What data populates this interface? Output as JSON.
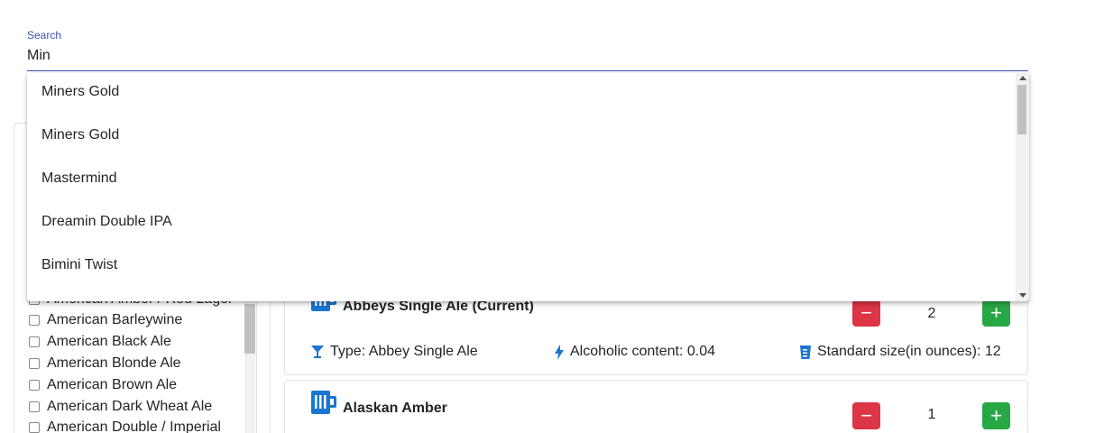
{
  "search": {
    "label": "Search",
    "value": "Min",
    "accent_color": "#3f51b5"
  },
  "autocomplete": {
    "options": [
      "Miners Gold",
      "Miners Gold",
      "Mastermind",
      "Dreamin Double IPA",
      "Bimini Twist"
    ]
  },
  "filters": {
    "items": [
      "American Amber / Red Lager",
      "American Barleywine",
      "American Black Ale",
      "American Blonde Ale",
      "American Brown Ale",
      "American Dark Wheat Ale",
      "American Double / Imperial"
    ]
  },
  "beers": [
    {
      "name": "Abbeys Single Ale (Current)",
      "quantity": "2",
      "type": "Type: Abbey Single Ale",
      "alcohol": "Alcoholic content: 0.04",
      "size": "Standard size(in ounces): 12",
      "icon": "beer-mug-icon"
    },
    {
      "name": "Alaskan Amber",
      "quantity": "1",
      "icon": "beer-mug-icon"
    }
  ],
  "buttons": {
    "minus_label": "−",
    "plus_label": "+"
  },
  "colors": {
    "danger": "#dc3545",
    "success": "#28a745",
    "icon_blue": "#1976d2"
  }
}
